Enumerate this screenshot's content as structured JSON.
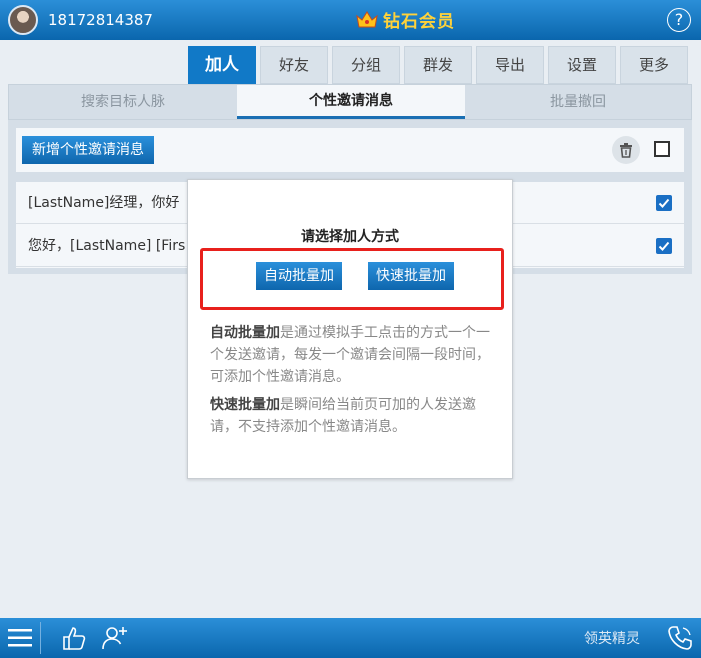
{
  "header": {
    "phone_number": "18172814387",
    "vip_label": "钻石会员",
    "help_symbol": "?"
  },
  "nav": {
    "tabs": [
      {
        "label": "加人",
        "active": true
      },
      {
        "label": "好友"
      },
      {
        "label": "分组"
      },
      {
        "label": "群发"
      },
      {
        "label": "导出"
      },
      {
        "label": "设置"
      },
      {
        "label": "更多"
      }
    ]
  },
  "subtabs": [
    {
      "label": "搜索目标人脉"
    },
    {
      "label": "个性邀请消息",
      "active": true
    },
    {
      "label": "批量撤回"
    }
  ],
  "toolbar": {
    "add_label": "新增个性邀请消息"
  },
  "messages": [
    {
      "text": "[LastName]经理，你好",
      "checked": true
    },
    {
      "text": "您好，[LastName] [Firs",
      "checked": true
    }
  ],
  "modal": {
    "title": "请选择加人方式",
    "auto_button": "自动批量加",
    "fast_button": "快速批量加",
    "auto_desc_bold": "自动批量加",
    "auto_desc": "是通过模拟手工点击的方式一个一个发送邀请，每发一个邀请会间隔一段时间，可添加个性邀请消息。",
    "fast_desc_bold": "快速批量加",
    "fast_desc": "是瞬间给当前页可加的人发送邀请，不支持添加个性邀请消息。"
  },
  "footer": {
    "brand": "领英精灵"
  },
  "colors": {
    "primary": "#1179c7",
    "vip": "#ffd23a",
    "highlight_frame": "#e8201c"
  }
}
